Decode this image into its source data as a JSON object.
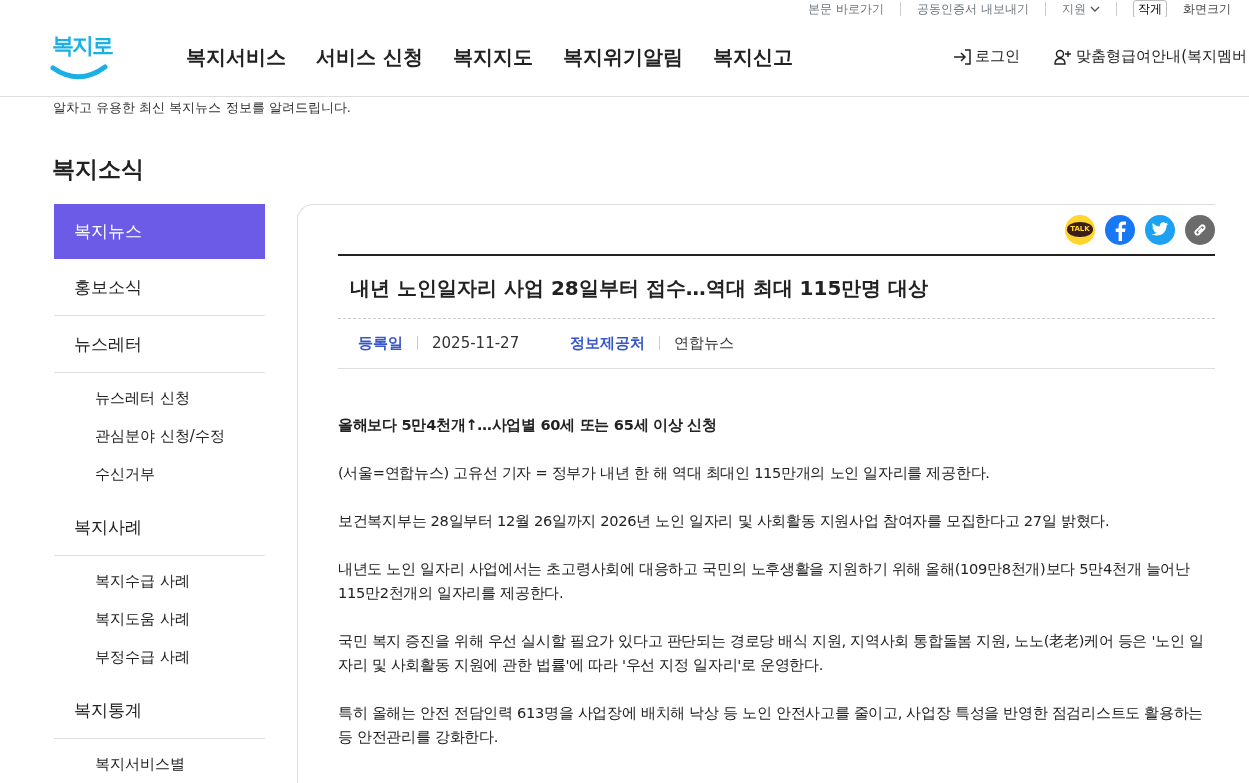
{
  "utility_bar": {
    "links": [
      "본문 바로가기",
      "공동인증서 내보내기"
    ],
    "language": "지원",
    "size_button": "작게",
    "size_label": "화면크기"
  },
  "header": {
    "logo": "복지로",
    "nav": [
      "복지서비스",
      "서비스 신청",
      "복지지도",
      "복지위기알림",
      "복지신고"
    ],
    "login": "로그인",
    "membership": "맞춤형급여안내(복지멤버"
  },
  "intro": "알차고 유용한 최신 복지뉴스 정보를 알려드립니다.",
  "page_title": "복지소식",
  "sidebar": {
    "items": [
      {
        "label": "복지뉴스",
        "selected": true
      },
      {
        "label": "홍보소식",
        "selected": false
      },
      {
        "label": "뉴스레터",
        "selected": false,
        "children": [
          {
            "label": "뉴스레터 신청",
            "selected": false
          },
          {
            "label": "관심분야 신청/수정",
            "selected": false
          },
          {
            "label": "수신거부",
            "selected": false
          }
        ]
      },
      {
        "label": "복지사례",
        "selected": false,
        "children": [
          {
            "label": "복지수급 사례",
            "selected": false
          },
          {
            "label": "복지도움 사례",
            "selected": false
          },
          {
            "label": "부정수급 사례",
            "selected": false
          }
        ]
      },
      {
        "label": "복지통계",
        "selected": false,
        "children": [
          {
            "label": "복지서비스별",
            "selected": false
          }
        ]
      }
    ]
  },
  "share": {
    "kakao_label": "TALK"
  },
  "article": {
    "title": "내년 노인일자리 사업 28일부터 접수…역대 최대 115만명 대상",
    "meta": [
      {
        "label": "등록일",
        "value": "2025-11-27"
      },
      {
        "label": "정보제공처",
        "value": "연합뉴스"
      }
    ],
    "paragraphs": [
      {
        "kind": "heading",
        "text": "올해보다 5만4천개↑…사업별 60세 또는 65세 이상 신청"
      },
      {
        "kind": "body",
        "text": "(서울=연합뉴스) 고유선 기자 = 정부가 내년 한 해 역대 최대인 115만개의 노인 일자리를 제공한다."
      },
      {
        "kind": "body",
        "text": "보건복지부는 28일부터 12월 26일까지 2026년 노인 일자리 및 사회활동 지원사업 참여자를 모집한다고 27일 밝혔다."
      },
      {
        "kind": "body",
        "text": "내년도 노인 일자리 사업에서는 초고령사회에 대응하고 국민의 노후생활을 지원하기 위해 올해(109만8천개)보다 5만4천개 늘어난 115만2천개의 일자리를 제공한다."
      },
      {
        "kind": "body",
        "text": "국민 복지 증진을 위해 우선 실시할 필요가 있다고 판단되는 경로당 배식 지원, 지역사회 통합돌봄 지원, 노노(老老)케어 등은 '노인 일자리 및 사회활동 지원에 관한 법률'에 따라 '우선 지정 일자리'로 운영한다."
      },
      {
        "kind": "body",
        "text": "특히 올해는 안전 전담인력 613명을 사업장에 배치해 낙상 등 노인 안전사고를 줄이고, 사업장 특성을 반영한 점검리스트도 활용하는 등 안전관리를 강화한다."
      }
    ]
  }
}
